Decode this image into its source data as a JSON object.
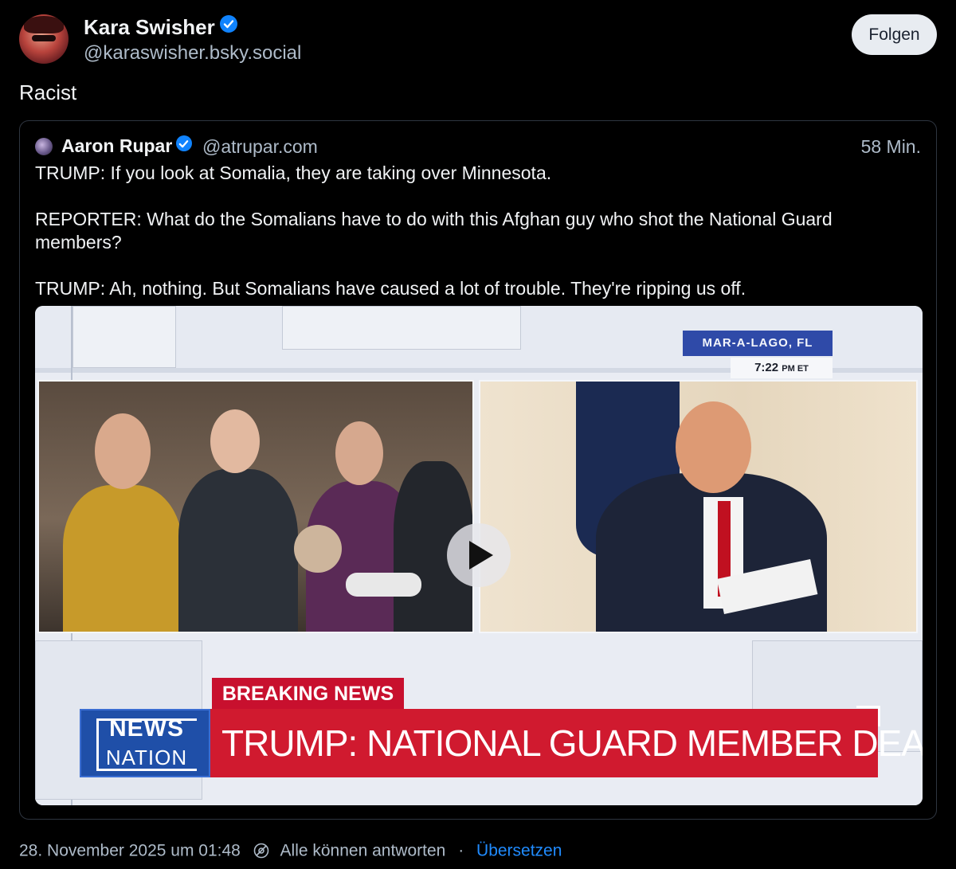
{
  "post": {
    "author_name": "Kara Swisher",
    "author_handle": "@karaswisher.bsky.social",
    "follow_label": "Folgen",
    "text": "Racist",
    "timestamp": "28. November 2025 um 01:48",
    "reply_setting": "Alle können antworten",
    "separator": "·",
    "translate_label": "Übersetzen",
    "verified_icon": "verified-badge-icon",
    "reply_icon": "reply-settings-icon"
  },
  "quote": {
    "author_name": "Aaron Rupar",
    "author_handle": "@atrupar.com",
    "time_ago": "58 Min.",
    "paragraphs": [
      "TRUMP: If you look at Somalia, they are taking over Minnesota.",
      "REPORTER: What do the Somalians have to do with this Afghan guy who shot the National Guard members?",
      "TRUMP: Ah, nothing. But Somalians have caused a lot of trouble. They're ripping us off."
    ]
  },
  "video": {
    "location": "MAR-A-LAGO, FL",
    "time": "7:22",
    "time_suffix": "PM ET",
    "breaking_label": "BREAKING NEWS",
    "logo_line1": "NEWS",
    "logo_line2": "NATION",
    "headline": "TRUMP: NATIONAL GUARD MEMBER DEAD",
    "play_icon": "play-icon"
  },
  "colors": {
    "background": "#000000",
    "accent_blue": "#208bfe",
    "verified_blue": "#1083fe",
    "muted_text": "#aebbc9",
    "news_red": "#d01a2f",
    "news_blue": "#1f4fa8"
  }
}
